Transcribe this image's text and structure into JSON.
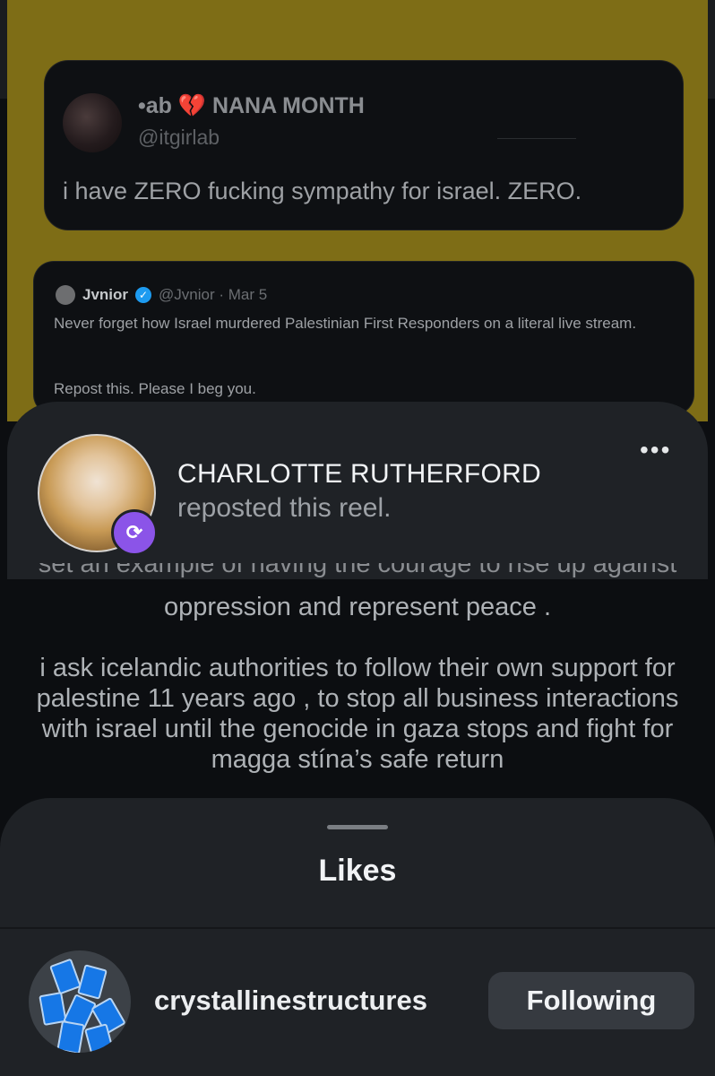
{
  "tweet": {
    "display_name": "•ab 💔 NANA MONTH",
    "handle": "@itgirlab",
    "text": "i have ZERO fucking sympathy for israel. ZERO."
  },
  "quoted": {
    "name": "Jvnior",
    "meta": "@Jvnior · Mar 5",
    "text": "Never forget how Israel murdered Palestinian First Responders on a literal live stream.",
    "repost_text": "Repost this. Please I beg you."
  },
  "repost": {
    "name": "CHARLOTTE RUTHERFORD",
    "subtitle": "reposted this reel.",
    "more_icon": "more-horizontal-icon",
    "badge_icon": "repost-icon",
    "badge_color": "#8b54e8"
  },
  "caption": {
    "cut_line": "set an example of having the courage to rise up against",
    "line1": "oppression and represent peace .",
    "paragraph": "i ask icelandic authorities to follow their own support for palestine 11 years ago , to stop all business interactions with israel until the genocide in gaza stops and fight for magga stína’s safe return"
  },
  "likes_sheet": {
    "title": "Likes",
    "items": [
      {
        "username": "crystallinestructures",
        "button": "Following"
      }
    ]
  },
  "colors": {
    "background_yellow": "#7e6d16",
    "panel": "#1f2226"
  }
}
